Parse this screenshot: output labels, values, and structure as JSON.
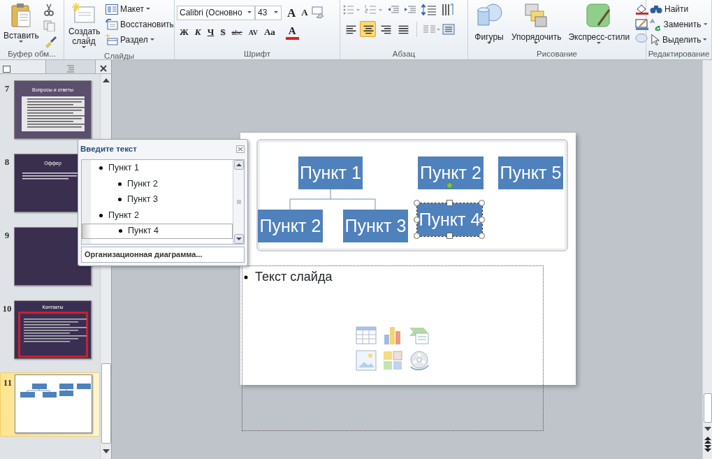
{
  "ribbon": {
    "clipboard": {
      "paste": "Вставить",
      "group": "Буфер обм..."
    },
    "slides": {
      "new_slide": "Создать слайд",
      "layout": "Макет",
      "reset": "Восстановить",
      "section": "Раздел",
      "group": "Слайды"
    },
    "font": {
      "font_name": "Calibri (Основно",
      "font_size": "43",
      "grow": "A",
      "shrink": "A",
      "format_buttons": [
        {
          "kind": "bold",
          "text": "Ж"
        },
        {
          "kind": "italic",
          "text": "К"
        },
        {
          "kind": "underline",
          "text": "Ч"
        },
        {
          "kind": "shadow",
          "text": "S"
        },
        {
          "kind": "strike",
          "text": "abc"
        },
        {
          "kind": "spacing",
          "text": "AV"
        },
        {
          "kind": "case",
          "text": "Aa"
        }
      ],
      "color_button": "A",
      "group": "Шрифт"
    },
    "paragraph": {
      "align": [
        {
          "kind": "left",
          "selected": false
        },
        {
          "kind": "center",
          "selected": true
        },
        {
          "kind": "right",
          "selected": false
        },
        {
          "kind": "justify",
          "selected": false
        }
      ],
      "group": "Абзац"
    },
    "drawing": {
      "shapes": "Фигуры",
      "arrange": "Упорядочить",
      "styles": "Экспресс-стили",
      "group": "Рисование"
    },
    "editing": {
      "find": "Найти",
      "replace": "Заменить",
      "select": "Выделить",
      "group": "Редактирование"
    }
  },
  "slides_panel": {
    "slides": [
      {
        "number": "7",
        "kind": "table",
        "title": "Вопросы и ответы",
        "selected": false
      },
      {
        "number": "8",
        "kind": "text",
        "title": "Оффер",
        "selected": false
      },
      {
        "number": "9",
        "kind": "blank",
        "selected": false
      },
      {
        "number": "10",
        "kind": "framed",
        "title": "Контакты",
        "selected": false
      },
      {
        "number": "11",
        "kind": "diagram",
        "selected": true
      }
    ]
  },
  "text_pane": {
    "title": "Введите текст",
    "items": [
      {
        "text": "Пункт 1",
        "selected": false,
        "children": [
          {
            "text": "Пункт 2",
            "selected": false
          },
          {
            "text": "Пункт 3",
            "selected": false
          }
        ]
      },
      {
        "text": "Пункт 2",
        "selected": false,
        "children": [
          {
            "text": "Пункт 4",
            "selected": true
          }
        ]
      }
    ],
    "footer": "Организационная диаграмма..."
  },
  "slide": {
    "diagram": [
      {
        "text": "Пункт 1",
        "selected": false,
        "children": [
          {
            "text": "Пункт 2",
            "selected": false
          },
          {
            "text": "Пункт 3",
            "selected": false
          }
        ]
      },
      {
        "text": "Пункт 2",
        "selected": false,
        "children": [
          {
            "text": "Пункт 4",
            "selected": true
          }
        ]
      },
      {
        "text": "Пункт 5",
        "selected": false
      }
    ],
    "body": "Текст слайда"
  }
}
